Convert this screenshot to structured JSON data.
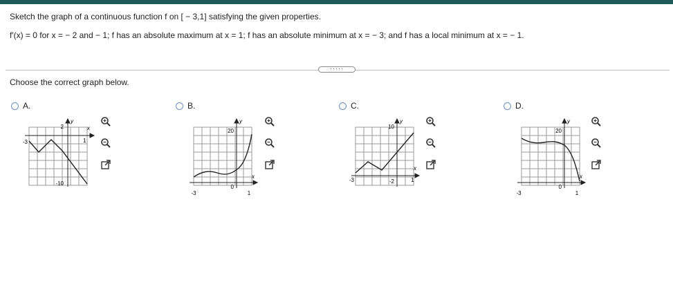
{
  "question": {
    "prompt": "Sketch the graph of a continuous function f on [ − 3,1] satisfying the given properties.",
    "properties": "f′(x) = 0 for x = − 2 and − 1; f has an absolute maximum at x = 1; f has an absolute minimum at x = − 3; and f has a local minimum at x = − 1.",
    "more_label": "·····",
    "instruction": "Choose the correct graph below."
  },
  "options": [
    {
      "label": "A.",
      "ticks": {
        "y_top": "2",
        "y_bottom": "-10",
        "x_left": "-3",
        "x_right": "1",
        "axis_x": "x",
        "axis_y": "y"
      }
    },
    {
      "label": "B.",
      "ticks": {
        "y_top": "20",
        "y_bottom": "0",
        "x_left": "-3",
        "x_right": "1",
        "axis_x": "x",
        "axis_y": "y"
      }
    },
    {
      "label": "C.",
      "ticks": {
        "y_top": "10",
        "y_bottom": "-2",
        "x_left": "-3",
        "x_right": "1",
        "axis_x": "x",
        "axis_y": "y"
      }
    },
    {
      "label": "D.",
      "ticks": {
        "y_top": "20",
        "y_bottom": "0",
        "x_left": "-3",
        "x_right": "1",
        "axis_x": "x",
        "axis_y": "y"
      }
    }
  ],
  "icons": {
    "zoom_in": "zoom-in-icon",
    "zoom_out": "zoom-out-icon",
    "popout": "popout-icon"
  },
  "colors": {
    "topbar": "#1e5a56",
    "radio_border": "#6a8fbf",
    "curve": "#222222",
    "grid": "#9a9a9a"
  }
}
